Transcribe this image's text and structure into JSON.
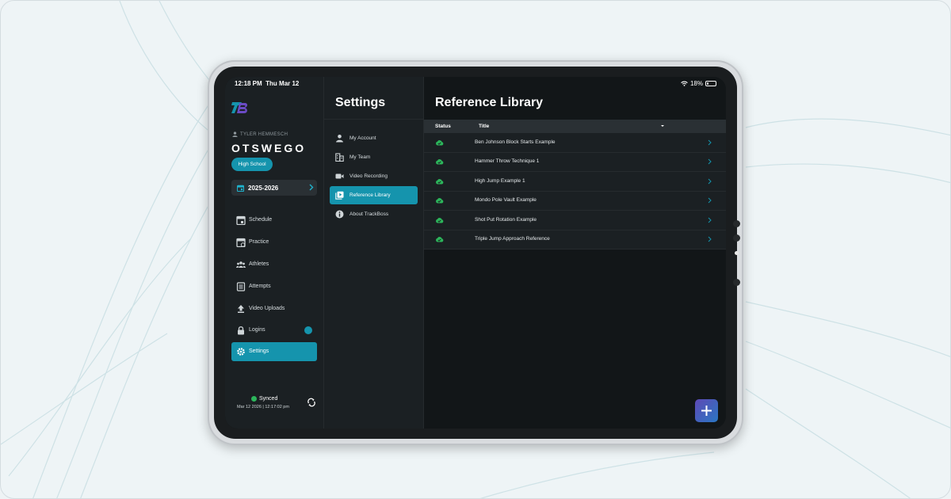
{
  "status_bar": {
    "time": "12:18 PM",
    "date": "Thu Mar 12",
    "battery": "18%",
    "battery_level": 0.18
  },
  "sidebar": {
    "user_name": "TYLER HEMMESCH",
    "team_name": "OTSWEGO",
    "level": "High School",
    "season": "2025-2026",
    "items": [
      {
        "label": "Schedule",
        "icon": "calendar-icon"
      },
      {
        "label": "Practice",
        "icon": "calendar-check-icon"
      },
      {
        "label": "Athletes",
        "icon": "people-icon"
      },
      {
        "label": "Attempts",
        "icon": "list-icon"
      },
      {
        "label": "Video Uploads",
        "icon": "upload-icon"
      },
      {
        "label": "Logins",
        "icon": "lock-icon"
      },
      {
        "label": "Settings",
        "icon": "gear-icon"
      }
    ],
    "sync_status": "Synced",
    "sync_time": "Mar 12 2026  |  12:17:02 pm"
  },
  "settings": {
    "title": "Settings",
    "items": [
      {
        "label": "My Account",
        "icon": "person-icon"
      },
      {
        "label": "My Team",
        "icon": "building-icon"
      },
      {
        "label": "Video Recording",
        "icon": "video-icon"
      },
      {
        "label": "Reference Library",
        "icon": "library-icon"
      },
      {
        "label": "About TrackBoss",
        "icon": "info-icon"
      }
    ]
  },
  "main": {
    "title": "Reference Library",
    "columns": {
      "status": "Status",
      "title": "Title"
    },
    "rows": [
      {
        "title": "Ben Johnson Block Starts Example",
        "status": "cloud-synced-icon"
      },
      {
        "title": "Hammer Throw Technique 1",
        "status": "cloud-synced-icon"
      },
      {
        "title": "High Jump Example 1",
        "status": "cloud-synced-icon"
      },
      {
        "title": "Mondo Pole Vault Example",
        "status": "cloud-synced-icon"
      },
      {
        "title": "Shot Put Rotation Example",
        "status": "cloud-synced-icon"
      },
      {
        "title": "Triple Jump Approach Reference",
        "status": "cloud-synced-icon"
      }
    ]
  },
  "colors": {
    "accent": "#1594ad",
    "synced": "#2cb65b",
    "background": "#121618",
    "panel": "#1b2023"
  }
}
